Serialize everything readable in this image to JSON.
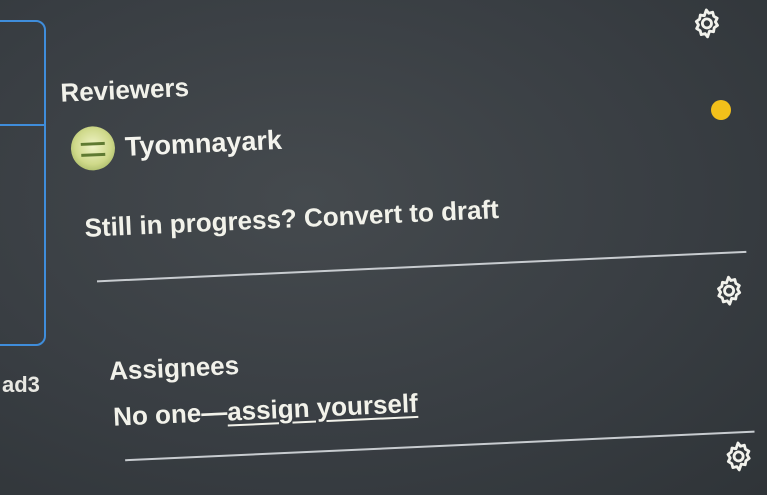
{
  "left_panel": {
    "fragment_text": "ad3"
  },
  "reviewers": {
    "title": "Reviewers",
    "items": [
      {
        "name": "Tyomnayark"
      }
    ],
    "status_color": "#f3c01a"
  },
  "draft": {
    "prompt": "Still in progress?",
    "link": "Convert to draft"
  },
  "assignees": {
    "title": "Assignees",
    "empty_text": "No one—",
    "link": "assign yourself"
  },
  "icons": {
    "settings": "gear-icon",
    "status": "status-dot"
  },
  "colors": {
    "accent_border": "#3f8ddb",
    "background": "#3a3f44",
    "text": "#ecece6"
  }
}
